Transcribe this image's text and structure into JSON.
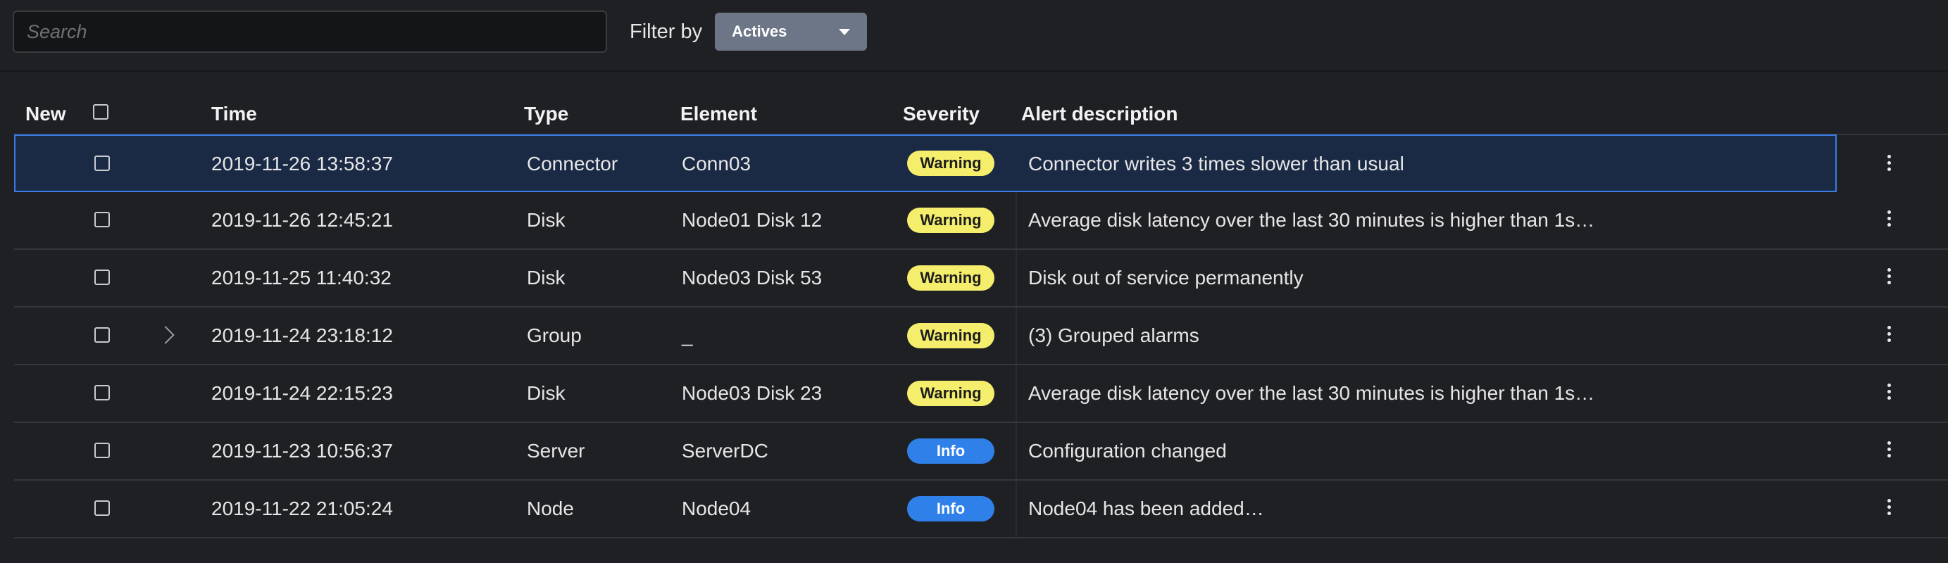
{
  "toolbar": {
    "search_placeholder": "Search",
    "filter_label": "Filter by",
    "filter_value": "Actives"
  },
  "table": {
    "headers": {
      "new": "New",
      "time": "Time",
      "type": "Type",
      "element": "Element",
      "severity": "Severity",
      "description": "Alert description"
    },
    "rows": [
      {
        "time": "2019-11-26 13:58:37",
        "type": "Connector",
        "element": "Conn03",
        "severity": "Warning",
        "description": "Connector writes 3 times slower than usual"
      },
      {
        "time": "2019-11-26 12:45:21",
        "type": "Disk",
        "element": "Node01 Disk 12",
        "severity": "Warning",
        "description": "Average disk latency over the last 30 minutes is higher than 1s…"
      },
      {
        "time": "2019-11-25 11:40:32",
        "type": "Disk",
        "element": "Node03 Disk 53",
        "severity": "Warning",
        "description": "Disk out of service permanently"
      },
      {
        "time": "2019-11-24 23:18:12",
        "type": "Group",
        "element": "_",
        "severity": "Warning",
        "description": "(3) Grouped alarms"
      },
      {
        "time": "2019-11-24 22:15:23",
        "type": "Disk",
        "element": "Node03 Disk 23",
        "severity": "Warning",
        "description": "Average disk latency over the last 30 minutes is higher than 1s…"
      },
      {
        "time": "2019-11-23 10:56:37",
        "type": "Server",
        "element": "ServerDC",
        "severity": "Info",
        "description": "Configuration changed"
      },
      {
        "time": "2019-11-22 21:05:24",
        "type": "Node",
        "element": "Node04",
        "severity": "Info",
        "description": "Node04 has been added…"
      }
    ]
  },
  "colors": {
    "background": "#1f2023",
    "selected_row": "#1b2a44",
    "selected_border": "#3a7ce6",
    "warning_badge": "#f5ee6c",
    "info_badge": "#2f80e8",
    "filter_select": "#6d7686"
  },
  "icons": {
    "dropdown": "caret-down-icon",
    "expand": "chevron-right-icon",
    "row_menu": "more-vertical-icon"
  }
}
